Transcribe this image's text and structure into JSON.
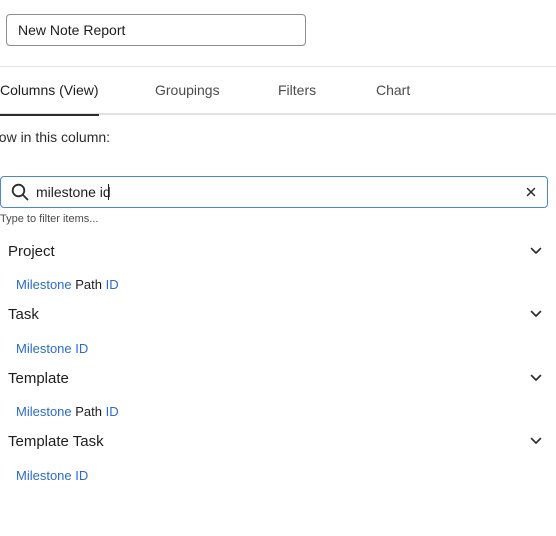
{
  "report": {
    "name_value": "New Note Report"
  },
  "tabs": [
    {
      "label": "Columns (View)",
      "active": true
    },
    {
      "label": "Groupings",
      "active": false
    },
    {
      "label": "Filters",
      "active": false
    },
    {
      "label": "Chart",
      "active": false
    }
  ],
  "column_panel": {
    "show_label": "how in this column:",
    "search": {
      "value": "milestone id",
      "icon": "search-icon",
      "clear_icon": "close-icon"
    },
    "helper_text": "Type to filter items...",
    "groups": [
      {
        "label": "Project",
        "icon": "chevron-down-icon",
        "item": {
          "part1": "Milestone",
          "part2": " Path ",
          "part3": "ID"
        }
      },
      {
        "label": "Task",
        "icon": "chevron-down-icon",
        "item": {
          "part1": "Milestone ID"
        }
      },
      {
        "label": "Template",
        "icon": "chevron-down-icon",
        "item": {
          "part1": "Milestone",
          "part2": " Path ",
          "part3": "ID"
        }
      },
      {
        "label": "Template Task",
        "icon": "chevron-down-icon",
        "item": {
          "part1": "Milestone ID"
        }
      }
    ]
  },
  "colors": {
    "highlight": "#2b6cc7",
    "focus_border": "#4b89c8",
    "text": "#1d1d1d"
  }
}
